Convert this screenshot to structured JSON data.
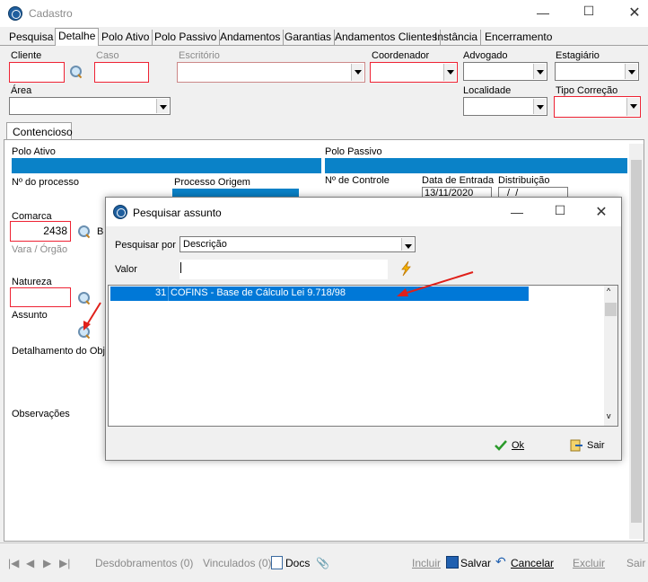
{
  "window": {
    "title": "Cadastro"
  },
  "tabs": [
    "Pesquisa",
    "Detalhe",
    "Polo Ativo",
    "Polo Passivo",
    "Andamentos",
    "Garantias",
    "Andamentos Clientes",
    "Instância",
    "Encerramento"
  ],
  "fields": {
    "cliente": "Cliente",
    "caso": "Caso",
    "escritorio": "Escritório",
    "coordenador": "Coordenador",
    "advogado": "Advogado",
    "estagiario": "Estagiário",
    "area": "Área",
    "localidade": "Localidade",
    "tipo_correcao": "Tipo Correção"
  },
  "subtab": "Contencioso",
  "left": {
    "polo_ativo": "Polo Ativo",
    "num_processo": "Nº do processo",
    "processo_origem": "Processo Origem",
    "comarca": "Comarca",
    "comarca_value": "2438",
    "comarca_suffix": "B",
    "vara": "Vara / Órgão",
    "natureza": "Natureza",
    "assunto": "Assunto",
    "detalhamento": "Detalhamento do Obje",
    "observacoes": "Observações"
  },
  "right": {
    "polo_passivo": "Polo Passivo",
    "num_controle": "Nº de Controle",
    "data_entrada": "Data de Entrada",
    "data_entrada_value": "13/11/2020",
    "distribuicao": "Distribuição",
    "distribuicao_value": " /  /"
  },
  "dialog": {
    "title": "Pesquisar assunto",
    "pesquisar_por_label": "Pesquisar por",
    "pesquisar_por_value": "Descrição",
    "valor_label": "Valor",
    "row": {
      "code": "31",
      "desc": "COFINS - Base de Cálculo Lei 9.718/98"
    },
    "ok": "Ok",
    "sair": "Sair"
  },
  "statusbar": {
    "desdobramentos": "Desdobramentos (0)",
    "vinculados": "Vinculados (0)",
    "docs": "Docs",
    "incluir": "Incluir",
    "salvar": "Salvar",
    "cancelar": "Cancelar",
    "excluir": "Excluir",
    "sair": "Sair"
  },
  "colors": {
    "accent": "#0a82c8",
    "selection": "#0078d7",
    "required": "#e22233",
    "annotation": "#e0201a"
  }
}
